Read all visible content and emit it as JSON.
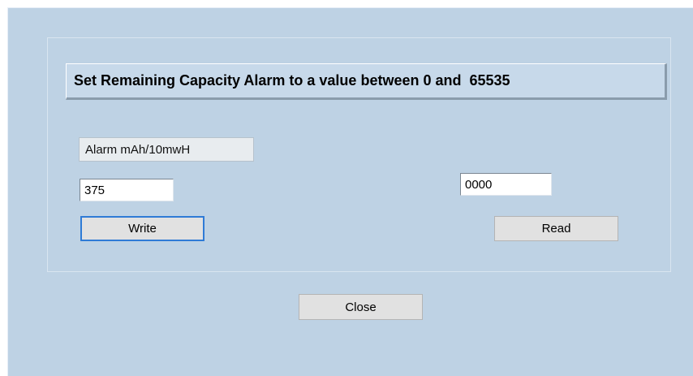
{
  "dialog": {
    "title": "Set Remaining Capacity Alarm to a value between 0 and  65535"
  },
  "alarm": {
    "label": "Alarm mAh/10mwH",
    "value": "375",
    "write_label": "Write"
  },
  "reading": {
    "value": "0000",
    "read_label": "Read"
  },
  "footer": {
    "close_label": "Close"
  },
  "colors": {
    "window_background": "#bed2e4",
    "button_face": "#e1e1e1",
    "focus_border": "#2f7bd6"
  }
}
